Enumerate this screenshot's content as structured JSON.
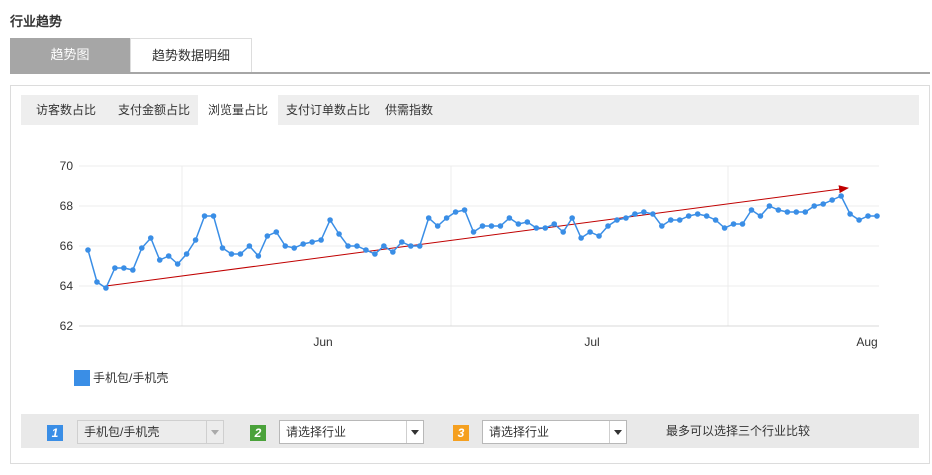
{
  "page_title": "行业趋势",
  "main_tabs": [
    {
      "label": "趋势图",
      "active": true
    },
    {
      "label": "趋势数据明细",
      "active": false
    }
  ],
  "sub_tabs": [
    {
      "label": "访客数占比",
      "active": false
    },
    {
      "label": "支付金额占比",
      "active": false
    },
    {
      "label": "浏览量占比",
      "active": true
    },
    {
      "label": "支付订单数占比",
      "active": false
    },
    {
      "label": "供需指数",
      "active": false
    }
  ],
  "chart_data": {
    "type": "line",
    "x_tick_labels": [
      "Jun",
      "Jul",
      "Aug"
    ],
    "y_ticks": [
      62,
      64,
      66,
      68,
      70
    ],
    "ylim": [
      62,
      70
    ],
    "grid": true,
    "legend_position": "bottom-left",
    "series": [
      {
        "name": "手机包/手机壳",
        "color": "#3a8ee6",
        "values": [
          65.8,
          64.2,
          63.9,
          64.9,
          64.9,
          64.8,
          65.9,
          66.4,
          65.3,
          65.5,
          65.1,
          65.6,
          66.3,
          67.5,
          67.5,
          65.9,
          65.6,
          65.6,
          66.0,
          65.5,
          66.5,
          66.7,
          66.0,
          65.9,
          66.1,
          66.2,
          66.3,
          67.3,
          66.6,
          66.0,
          66.0,
          65.8,
          65.6,
          66.0,
          65.7,
          66.2,
          66.0,
          66.0,
          67.4,
          67.0,
          67.4,
          67.7,
          67.8,
          66.7,
          67.0,
          67.0,
          67.0,
          67.4,
          67.1,
          67.2,
          66.9,
          66.9,
          67.1,
          66.7,
          67.4,
          66.4,
          66.7,
          66.5,
          67.0,
          67.3,
          67.4,
          67.6,
          67.7,
          67.6,
          67.0,
          67.3,
          67.3,
          67.5,
          67.6,
          67.5,
          67.3,
          66.9,
          67.1,
          67.1,
          67.8,
          67.5,
          68.0,
          67.8,
          67.7,
          67.7,
          67.7,
          68.0,
          68.1,
          68.3,
          68.5,
          67.6,
          67.3,
          67.5,
          67.5
        ]
      }
    ],
    "trend_arrow": {
      "color": "#c00000",
      "from_value": 64.0,
      "to_value": 68.9
    }
  },
  "legend": {
    "label": "手机包/手机壳",
    "color": "#3a8ee6"
  },
  "compare": {
    "slots": [
      {
        "number": "1",
        "badge_color": "#3a8ee6",
        "value": "手机包/手机壳",
        "disabled": true
      },
      {
        "number": "2",
        "badge_color": "#4aa23a",
        "value": "请选择行业",
        "disabled": false
      },
      {
        "number": "3",
        "badge_color": "#f5a020",
        "value": "请选择行业",
        "disabled": false
      }
    ],
    "hint": "最多可以选择三个行业比较"
  }
}
